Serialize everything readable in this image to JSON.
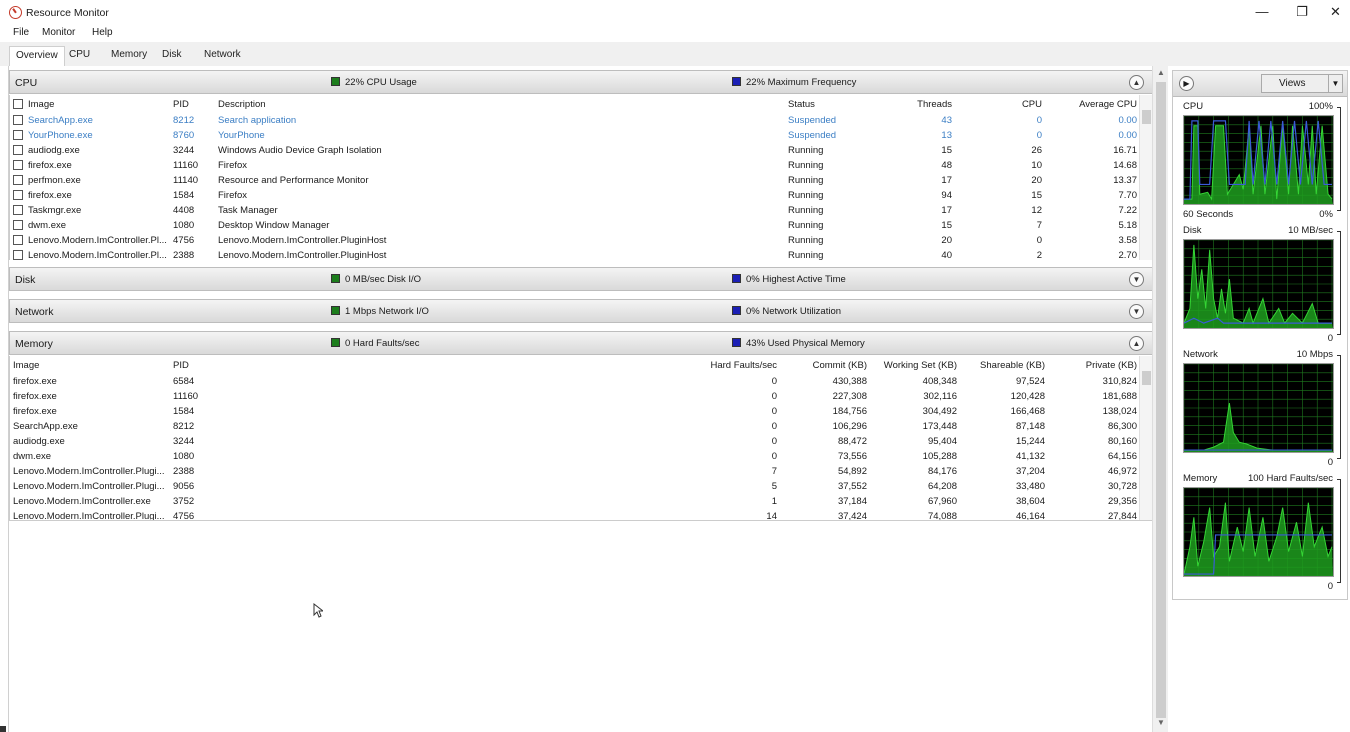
{
  "window": {
    "title": "Resource Monitor",
    "minimize": "—",
    "maximize": "❐",
    "close": "✕"
  },
  "menu": [
    "File",
    "Monitor",
    "Help"
  ],
  "tabs": [
    "Overview",
    "CPU",
    "Memory",
    "Disk",
    "Network"
  ],
  "active_tab": "Overview",
  "colors": {
    "green_indicator": "#1c7d1c",
    "blue_indicator": "#1b1fb5",
    "suspended_text": "#3b7ec4",
    "graph_bg": "#000000",
    "graph_grid": "#1f7a1f",
    "graph_line": "#35d635"
  },
  "cpu": {
    "title": "CPU",
    "indicator1": "22% CPU Usage",
    "indicator2": "22% Maximum Frequency",
    "columns": [
      "Image",
      "PID",
      "Description",
      "Status",
      "Threads",
      "CPU",
      "Average CPU"
    ],
    "rows": [
      [
        "SearchApp.exe",
        "8212",
        "Search application",
        "Suspended",
        "43",
        "0",
        "0.00"
      ],
      [
        "YourPhone.exe",
        "8760",
        "YourPhone",
        "Suspended",
        "13",
        "0",
        "0.00"
      ],
      [
        "audiodg.exe",
        "3244",
        "Windows Audio Device Graph Isolation",
        "Running",
        "15",
        "26",
        "16.71"
      ],
      [
        "firefox.exe",
        "11160",
        "Firefox",
        "Running",
        "48",
        "10",
        "14.68"
      ],
      [
        "perfmon.exe",
        "11140",
        "Resource and Performance Monitor",
        "Running",
        "17",
        "20",
        "13.37"
      ],
      [
        "firefox.exe",
        "1584",
        "Firefox",
        "Running",
        "94",
        "15",
        "7.70"
      ],
      [
        "Taskmgr.exe",
        "4408",
        "Task Manager",
        "Running",
        "17",
        "12",
        "7.22"
      ],
      [
        "dwm.exe",
        "1080",
        "Desktop Window Manager",
        "Running",
        "15",
        "7",
        "5.18"
      ],
      [
        "Lenovo.Modern.ImController.Pl...",
        "4756",
        "Lenovo.Modern.ImController.PluginHost",
        "Running",
        "20",
        "0",
        "3.58"
      ],
      [
        "Lenovo.Modern.ImController.Pl...",
        "2388",
        "Lenovo.Modern.ImController.PluginHost",
        "Running",
        "40",
        "2",
        "2.70"
      ]
    ]
  },
  "disk": {
    "title": "Disk",
    "indicator1": "0 MB/sec Disk I/O",
    "indicator2": "0% Highest Active Time"
  },
  "network": {
    "title": "Network",
    "indicator1": "1 Mbps Network I/O",
    "indicator2": "0% Network Utilization"
  },
  "memory": {
    "title": "Memory",
    "indicator1": "0 Hard Faults/sec",
    "indicator2": "43% Used Physical Memory",
    "columns": [
      "Image",
      "PID",
      "Hard Faults/sec",
      "Commit (KB)",
      "Working Set (KB)",
      "Shareable (KB)",
      "Private (KB)"
    ],
    "rows": [
      [
        "firefox.exe",
        "6584",
        "0",
        "430,388",
        "408,348",
        "97,524",
        "310,824"
      ],
      [
        "firefox.exe",
        "11160",
        "0",
        "227,308",
        "302,116",
        "120,428",
        "181,688"
      ],
      [
        "firefox.exe",
        "1584",
        "0",
        "184,756",
        "304,492",
        "166,468",
        "138,024"
      ],
      [
        "SearchApp.exe",
        "8212",
        "0",
        "106,296",
        "173,448",
        "87,148",
        "86,300"
      ],
      [
        "audiodg.exe",
        "3244",
        "0",
        "88,472",
        "95,404",
        "15,244",
        "80,160"
      ],
      [
        "dwm.exe",
        "1080",
        "0",
        "73,556",
        "105,288",
        "41,132",
        "64,156"
      ],
      [
        "Lenovo.Modern.ImController.Plugi...",
        "2388",
        "7",
        "54,892",
        "84,176",
        "37,204",
        "46,972"
      ],
      [
        "Lenovo.Modern.ImController.Plugi...",
        "9056",
        "5",
        "37,552",
        "64,208",
        "33,480",
        "30,728"
      ],
      [
        "Lenovo.Modern.ImController.exe",
        "3752",
        "1",
        "37,184",
        "67,960",
        "38,604",
        "29,356"
      ],
      [
        "Lenovo.Modern.ImController.Plugi...",
        "4756",
        "14",
        "37,424",
        "74,088",
        "46,164",
        "27,844"
      ]
    ]
  },
  "right_panel": {
    "views_label": "Views",
    "graphs": [
      {
        "name": "CPU",
        "top": "100%",
        "bottom_left": "60 Seconds",
        "bottom_right": "0%"
      },
      {
        "name": "Disk",
        "top": "10 MB/sec",
        "bottom_left": "",
        "bottom_right": "0"
      },
      {
        "name": "Network",
        "top": "10 Mbps",
        "bottom_left": "",
        "bottom_right": "0"
      },
      {
        "name": "Memory",
        "top": "100 Hard Faults/sec",
        "bottom_left": "",
        "bottom_right": "0"
      }
    ]
  }
}
